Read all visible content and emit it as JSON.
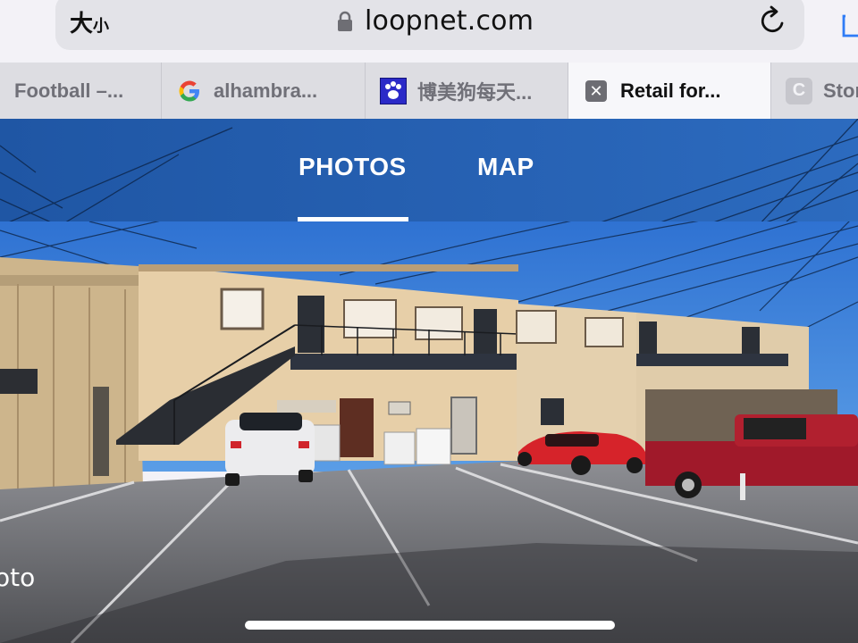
{
  "browser": {
    "reader_label": "大",
    "reader_label_small": "小",
    "url": "loopnet.com",
    "tabs": [
      {
        "title": "Football –...",
        "icon": "football-favicon"
      },
      {
        "title": "alhambra...",
        "icon": "google-icon"
      },
      {
        "title": "博美狗每天...",
        "icon": "paw-icon"
      },
      {
        "title": "Retail for...",
        "icon": "close-icon",
        "active": true
      },
      {
        "title": "Stor",
        "icon": "c-favicon"
      }
    ]
  },
  "listing": {
    "nav_tabs": [
      "PHOTOS",
      "MAP"
    ],
    "active_tab": "PHOTOS",
    "photo_caption": "oto"
  },
  "colors": {
    "nav_blue": "#2762b4",
    "tab_bar": "#dddde2",
    "active_tab": "#f7f7fa"
  }
}
